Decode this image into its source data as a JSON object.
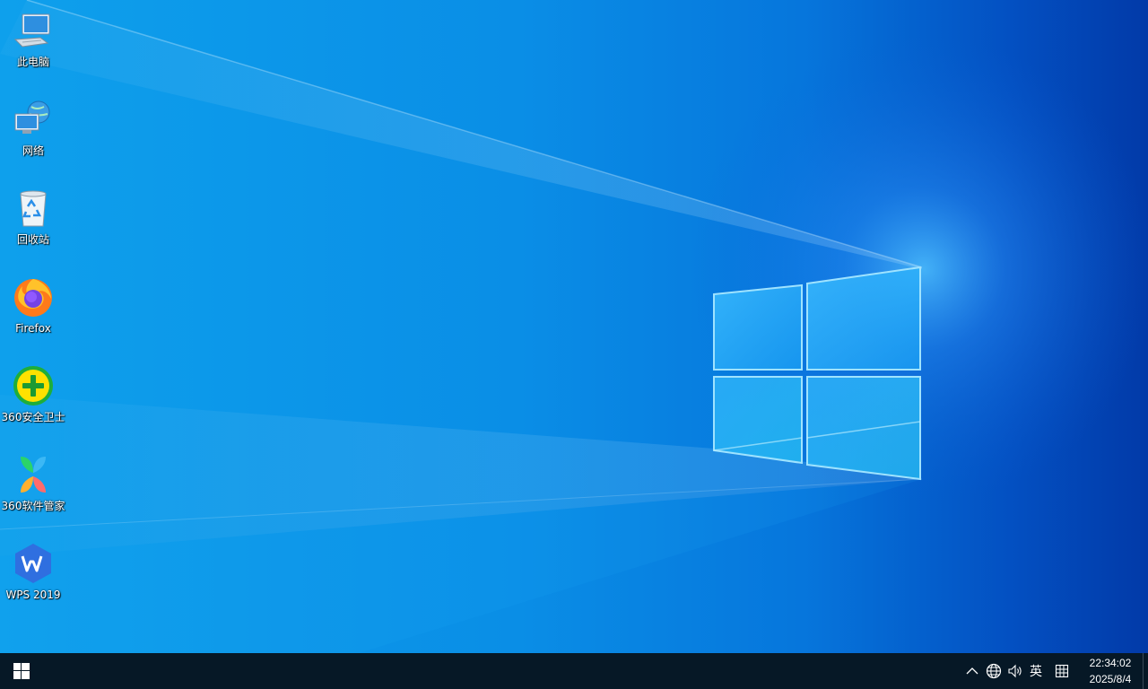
{
  "desktop": {
    "icons": [
      {
        "label": "此电脑",
        "icon": "computer-icon"
      },
      {
        "label": "网络",
        "icon": "network-icon"
      },
      {
        "label": "回收站",
        "icon": "recycle-bin-icon"
      },
      {
        "label": "Firefox",
        "icon": "firefox-icon"
      },
      {
        "label": "360安全卫士",
        "icon": "360-safe-icon"
      },
      {
        "label": "360软件管家",
        "icon": "360-software-manager-icon"
      },
      {
        "label": "WPS 2019",
        "icon": "wps-icon"
      }
    ],
    "wallpaper": "windows-10-light-beam-logo"
  },
  "taskbar": {
    "start_icon": "windows-start-icon",
    "tray": {
      "chevron_icon": "chevron-up-icon",
      "network_icon": "globe-network-icon",
      "volume_icon": "speaker-icon",
      "ime_label": "英",
      "keyboard_icon": "input-grid-icon"
    },
    "clock": {
      "time": "22:34:02",
      "date": "2025/8/4"
    }
  },
  "colors": {
    "taskbar_bg": "#061826",
    "desktop_light": "#0ea0ec",
    "desktop_dark": "#023aa8"
  }
}
